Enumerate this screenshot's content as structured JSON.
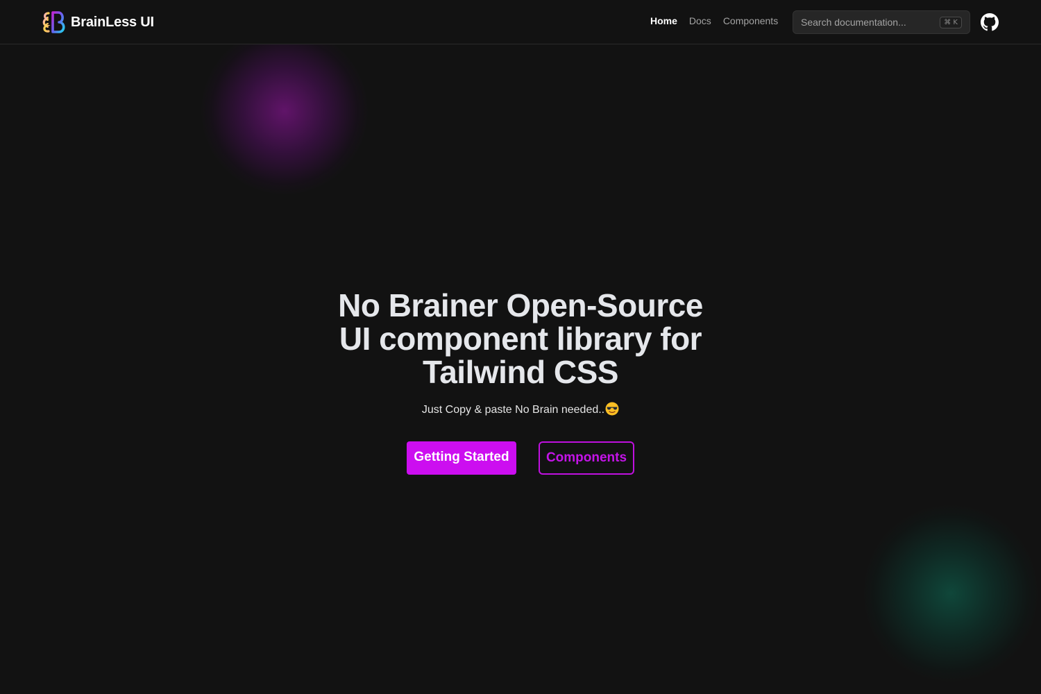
{
  "brand": {
    "name": "BrainLess UI",
    "logo_icon": "brainless-logo-icon"
  },
  "nav": {
    "items": [
      {
        "label": "Home",
        "active": true
      },
      {
        "label": "Docs",
        "active": false
      },
      {
        "label": "Components",
        "active": false
      }
    ]
  },
  "search": {
    "placeholder": "Search documentation...",
    "shortcut": "⌘ K",
    "icon": "none"
  },
  "github": {
    "icon": "github-icon"
  },
  "hero": {
    "title": "No Brainer Open-Source UI component library for Tailwind CSS",
    "subtitle": "Just Copy & paste No Brain needed..",
    "subtitle_emoji": "smiling-face-with-sunglasses-icon",
    "primary_button": "Getting Started",
    "secondary_button": "Components"
  },
  "colors": {
    "background": "#121212",
    "accent": "#cc0ef0",
    "glow_purple": "#6e1478",
    "glow_teal": "#0f5041"
  }
}
